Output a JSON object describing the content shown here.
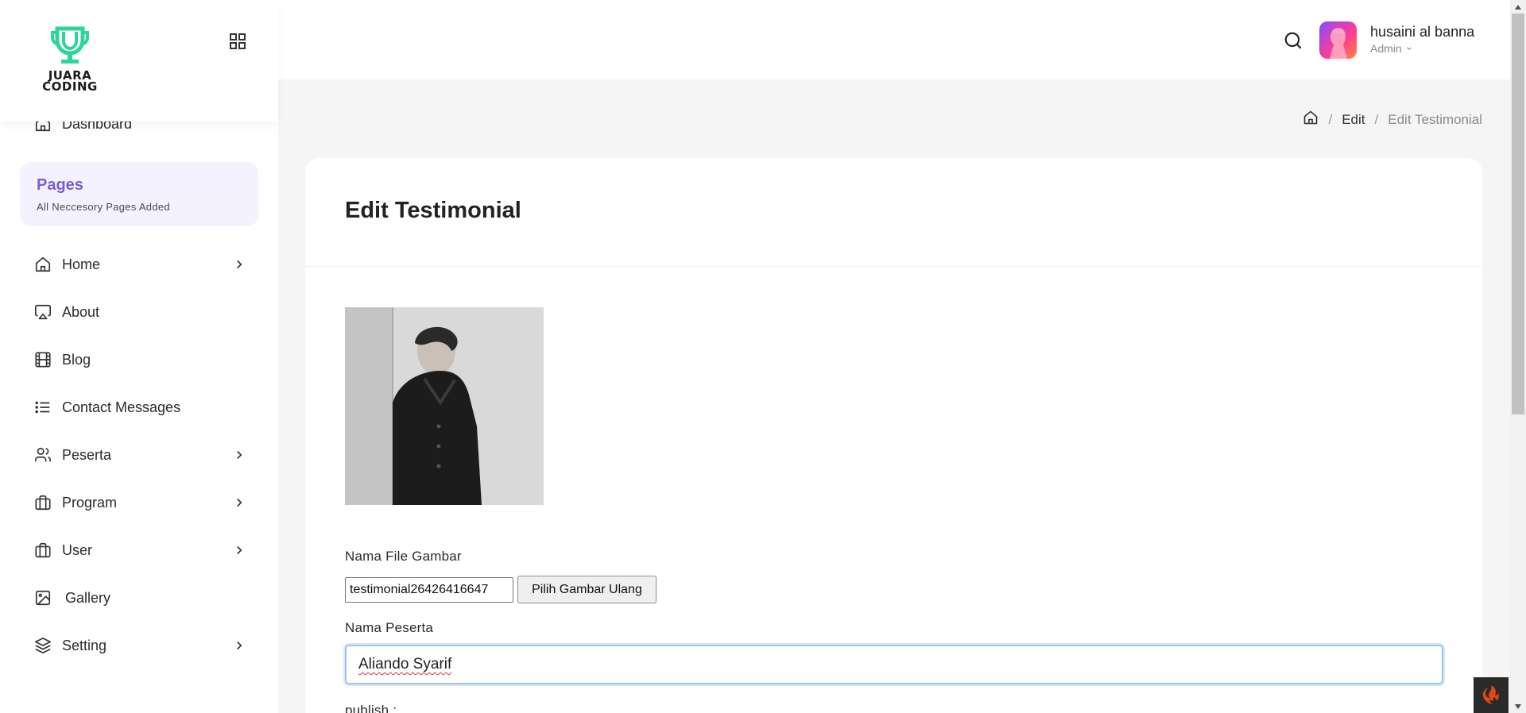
{
  "logo": {
    "text_line1": "JUARA",
    "text_line2": "CODING"
  },
  "sidebar": {
    "dashboard": "Dashboard",
    "pages_title": "Pages",
    "pages_subtitle": "All Neccesory Pages Added",
    "items": [
      {
        "label": "Home",
        "icon": "home-icon",
        "chevron": true
      },
      {
        "label": "About",
        "icon": "airplay-icon",
        "chevron": false
      },
      {
        "label": "Blog",
        "icon": "film-icon",
        "chevron": false
      },
      {
        "label": "Contact Messages",
        "icon": "list-icon",
        "chevron": false
      },
      {
        "label": "Peserta",
        "icon": "users-icon",
        "chevron": true
      },
      {
        "label": "Program",
        "icon": "briefcase-icon",
        "chevron": true
      },
      {
        "label": "User",
        "icon": "briefcase-icon",
        "chevron": true
      },
      {
        "label": "Gallery",
        "icon": "image-icon",
        "chevron": false
      },
      {
        "label": "Setting",
        "icon": "layers-icon",
        "chevron": true
      }
    ]
  },
  "header": {
    "user_name": "husaini al banna",
    "user_role": "Admin"
  },
  "breadcrumb": {
    "level1": "Edit",
    "level2": "Edit Testimonial"
  },
  "form": {
    "title": "Edit Testimonial",
    "file_label": "Nama File Gambar",
    "file_value": "testimonial26426416647",
    "file_button": "Pilih Gambar Ulang",
    "name_label": "Nama Peserta",
    "name_value": "Aliando Syarif",
    "publish_label": "publish :"
  },
  "colors": {
    "accent": "#7b5cd6",
    "logo_green": "#2ed59a",
    "focus_border": "#9ec3f0"
  }
}
